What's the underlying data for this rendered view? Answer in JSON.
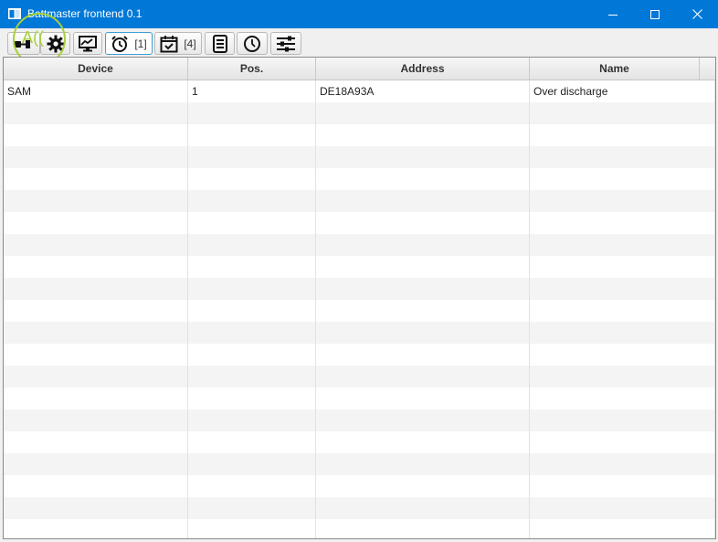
{
  "window": {
    "title": "Battmaster frontend 0.1",
    "accent": "#0078d7"
  },
  "toolbar": {
    "buttons": [
      {
        "icon": "battery-plug-icon",
        "label": ""
      },
      {
        "icon": "gear-icon",
        "label": ""
      },
      {
        "icon": "monitor-chart-icon",
        "label": ""
      },
      {
        "icon": "alarm-clock-icon",
        "label": "[1]",
        "selected": true
      },
      {
        "icon": "calendar-check-icon",
        "label": "[4]"
      },
      {
        "icon": "list-document-icon",
        "label": ""
      },
      {
        "icon": "clock-icon",
        "label": ""
      },
      {
        "icon": "sliders-icon",
        "label": ""
      }
    ],
    "overlay_label": "A(("
  },
  "table": {
    "columns": [
      "Device",
      "Pos.",
      "Address",
      "Name"
    ],
    "rows": [
      [
        "SAM",
        "1",
        "DE18A93A",
        "Over discharge"
      ]
    ]
  }
}
